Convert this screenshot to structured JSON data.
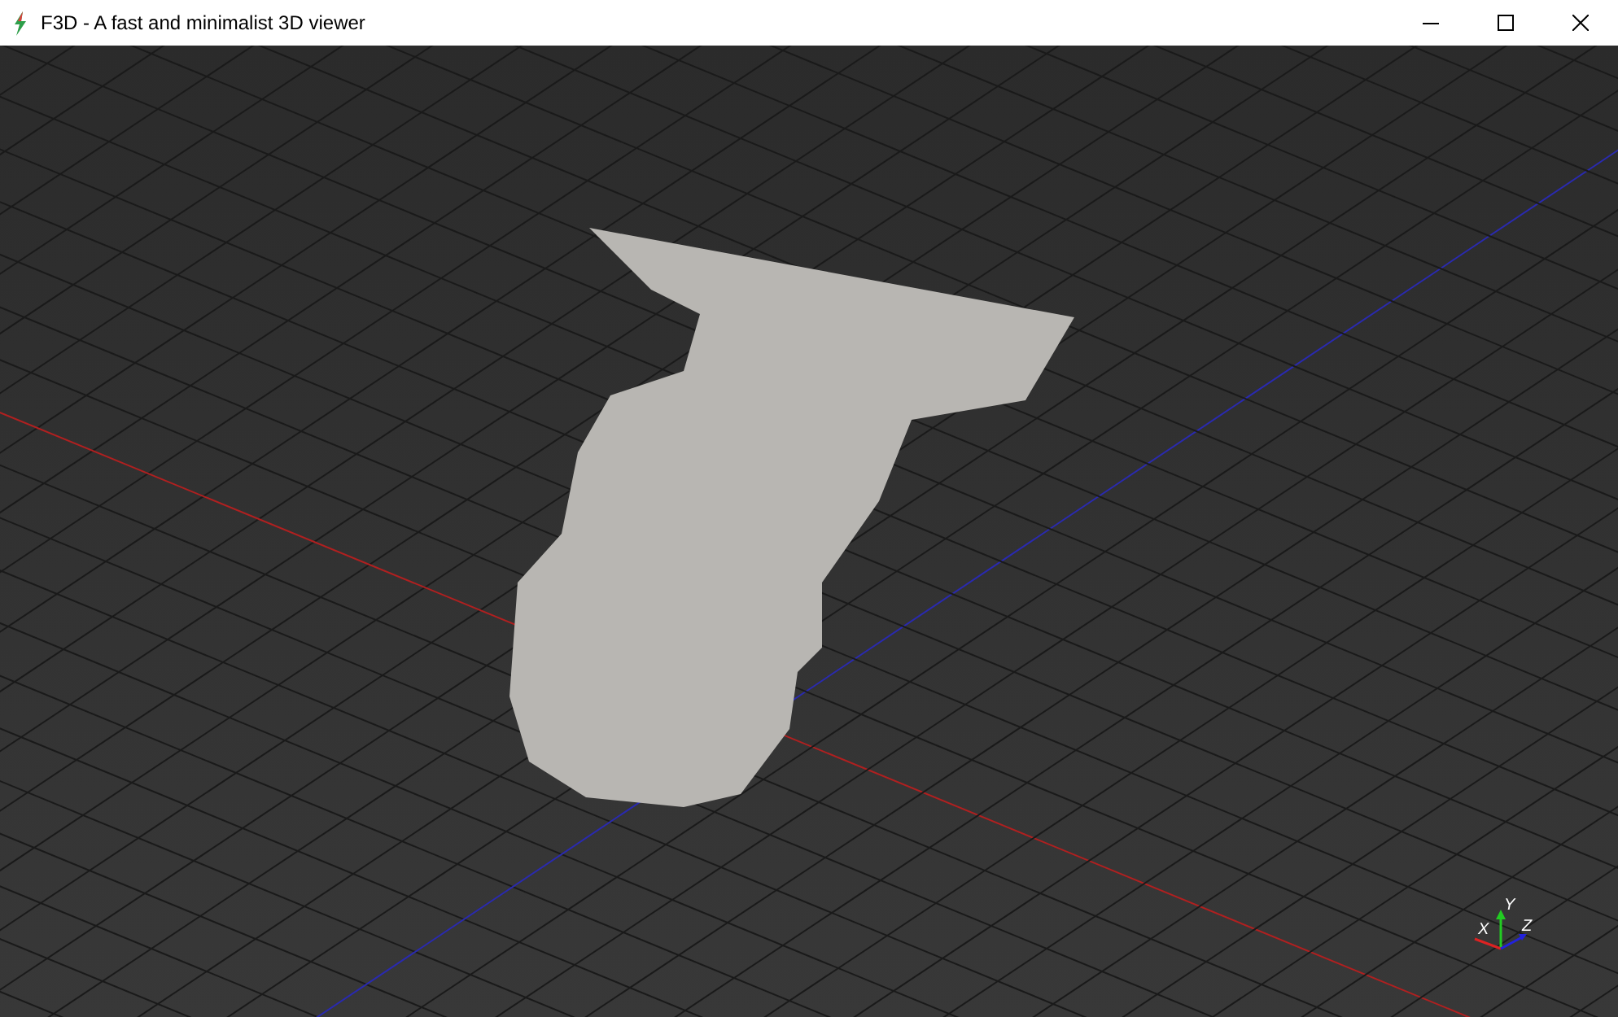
{
  "window": {
    "title": "F3D - A fast and minimalist 3D viewer"
  },
  "axis_widget": {
    "labels": [
      "X",
      "Y",
      "Z"
    ]
  }
}
